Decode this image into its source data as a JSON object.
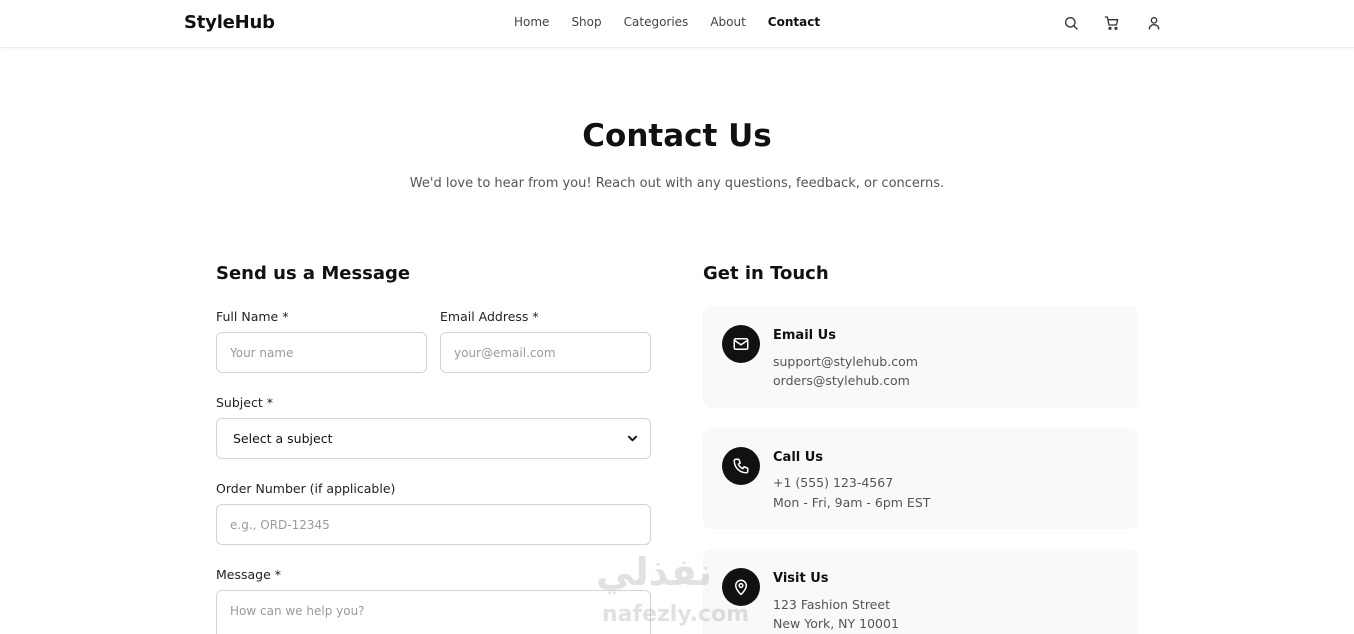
{
  "header": {
    "brand": "StyleHub",
    "nav": [
      "Home",
      "Shop",
      "Categories",
      "About",
      "Contact"
    ],
    "active_nav": "Contact",
    "icons": [
      "search-icon",
      "cart-icon",
      "user-icon"
    ]
  },
  "hero": {
    "title": "Contact Us",
    "subtitle": "We'd love to hear from you! Reach out with any questions, feedback, or concerns."
  },
  "form": {
    "title": "Send us a Message",
    "full_name": {
      "label": "Full Name *",
      "placeholder": "Your name",
      "value": ""
    },
    "email": {
      "label": "Email Address *",
      "placeholder": "your@email.com",
      "value": ""
    },
    "subject": {
      "label": "Subject *",
      "selected": "Select a subject"
    },
    "order_number": {
      "label": "Order Number (if applicable)",
      "placeholder": "e.g., ORD-12345",
      "value": ""
    },
    "message": {
      "label": "Message *",
      "placeholder": "How can we help you?",
      "value": ""
    }
  },
  "get_in_touch": {
    "title": "Get in Touch",
    "cards": [
      {
        "icon": "mail-icon",
        "title": "Email Us",
        "lines": [
          "support@stylehub.com",
          "orders@stylehub.com"
        ]
      },
      {
        "icon": "phone-icon",
        "title": "Call Us",
        "lines": [
          "+1 (555) 123-4567",
          "Mon - Fri, 9am - 6pm EST"
        ]
      },
      {
        "icon": "map-pin-icon",
        "title": "Visit Us",
        "lines": [
          "123 Fashion Street",
          "New York, NY 10001"
        ]
      }
    ]
  },
  "watermark": {
    "arabic": "نفذلي",
    "latin": "nafezly.com"
  },
  "colors": {
    "primary": "#111111",
    "card_bg": "#f8f9fa",
    "border": "#d4d4d8",
    "muted_text": "#555555"
  }
}
